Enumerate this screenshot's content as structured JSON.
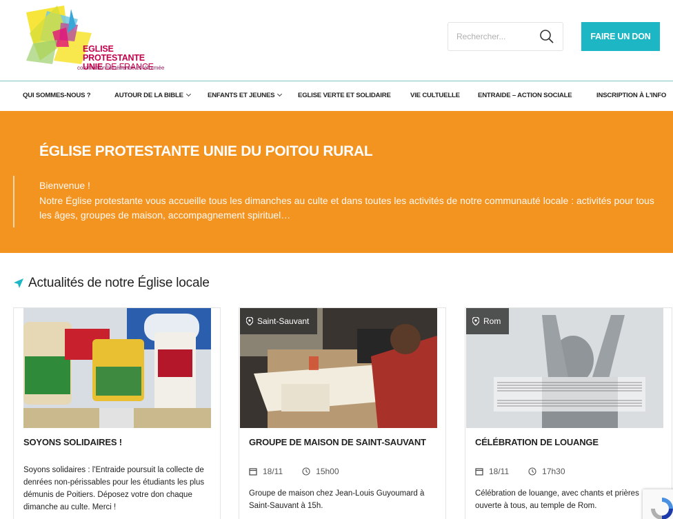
{
  "header": {
    "logo": {
      "line1": "EGLISE PROTESTANTE",
      "line2_bold": "UNIE",
      "line2_rest": " DE FRANCE",
      "line3": "communion luthérienne et réformée"
    },
    "search": {
      "placeholder": "Rechercher..."
    },
    "donate_label": "FAIRE UN DON"
  },
  "nav": {
    "items": [
      {
        "label": "QUI SOMMES-NOUS ?",
        "has_dropdown": false
      },
      {
        "label": "AUTOUR DE LA BIBLE",
        "has_dropdown": true
      },
      {
        "label": "ENFANTS ET JEUNES",
        "has_dropdown": true
      },
      {
        "label": "EGLISE VERTE ET SOLIDAIRE",
        "has_dropdown": false
      },
      {
        "label": "VIE CULTUELLE",
        "has_dropdown": false
      },
      {
        "label": "ENTRAIDE – ACTION SOCIALE",
        "has_dropdown": false
      },
      {
        "label": "INSCRIPTION À L'INFO",
        "has_dropdown": false
      }
    ]
  },
  "hero": {
    "title": "ÉGLISE PROTESTANTE UNIE DU POITOU RURAL",
    "line1": "Bienvenue !",
    "line2": "Notre Église protestante vous accueille tous les dimanches au culte et dans toutes les activités de notre communauté locale : activités pour tous les âges, groupes de maison, accompagnement spirituel…"
  },
  "news": {
    "title": "Actualités de notre Église locale",
    "cards": [
      {
        "location": "",
        "title": "SOYONS SOLIDAIRES !",
        "date": "",
        "time": "",
        "description": "Soyons solidaires : l'Entraide poursuit la collecte de denrées non-périssables pour les étudiants les plus démunis de Poitiers. Déposez votre don chaque dimanche au culte. Merci !"
      },
      {
        "location": "Saint-Sauvant",
        "title": "GROUPE DE MAISON DE SAINT-SAUVANT",
        "date": "18/11",
        "time": "15h00",
        "description": "Groupe de maison chez Jean-Louis Guyoumard à Saint-Sauvant à 15h."
      },
      {
        "location": "Rom",
        "title": "CÉLÉBRATION DE LOUANGE",
        "date": "18/11",
        "time": "17h30",
        "description": "Célébration de louange, avec chants et prières ouverte à tous, au temple de Rom."
      }
    ]
  },
  "colors": {
    "accent": "#1cb6c5",
    "hero_bg": "#f39421",
    "brand": "#c4004b"
  }
}
